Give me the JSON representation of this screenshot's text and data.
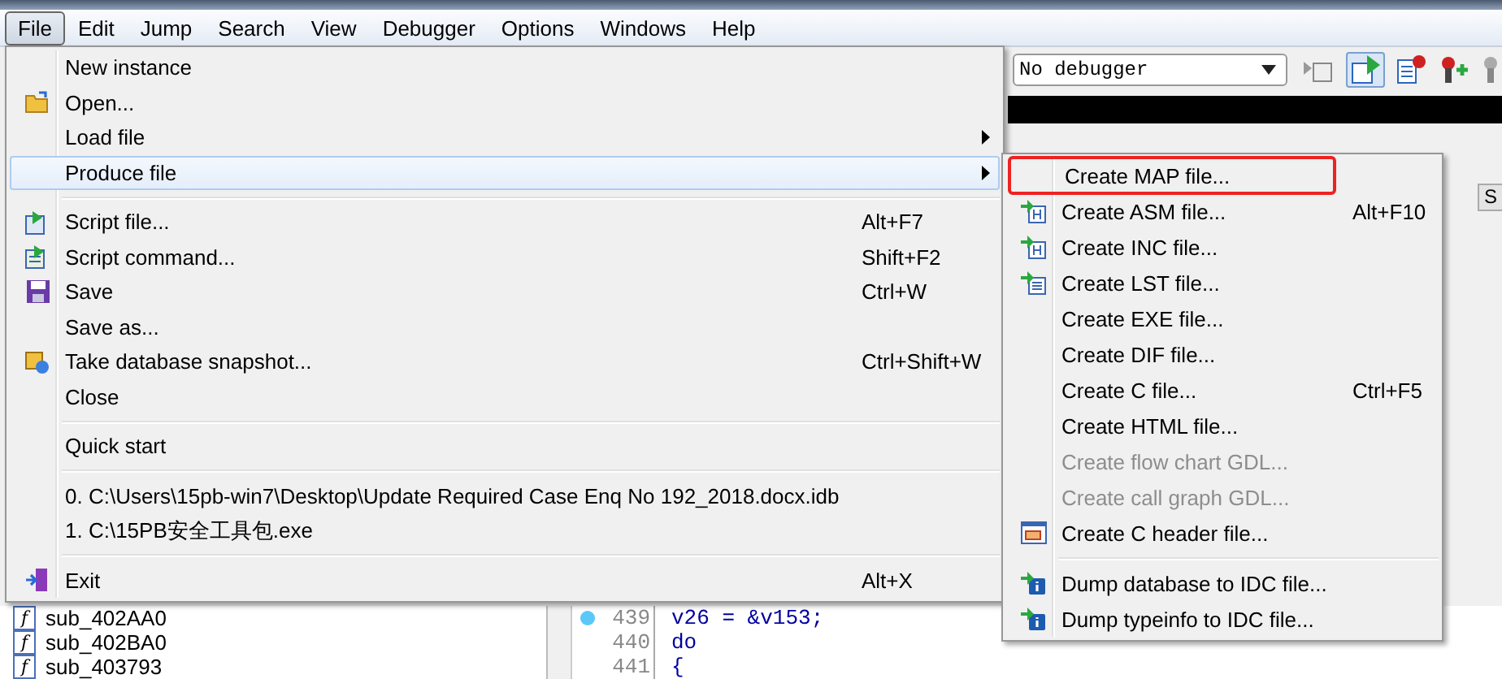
{
  "menubar": [
    {
      "label": "File",
      "selected": true
    },
    {
      "label": "Edit",
      "selected": false
    },
    {
      "label": "Jump",
      "selected": false
    },
    {
      "label": "Search",
      "selected": false
    },
    {
      "label": "View",
      "selected": false
    },
    {
      "label": "Debugger",
      "selected": false
    },
    {
      "label": "Options",
      "selected": false
    },
    {
      "label": "Windows",
      "selected": false
    },
    {
      "label": "Help",
      "selected": false
    }
  ],
  "toolbar": {
    "debugger_select": "No debugger"
  },
  "side_tab": {
    "label": "S"
  },
  "functions": [
    {
      "icon_glyph": "f",
      "name": "sub_402AA0"
    },
    {
      "icon_glyph": "f",
      "name": "sub_402BA0"
    },
    {
      "icon_glyph": "f",
      "name": "sub_403793"
    }
  ],
  "code_lines": [
    {
      "number": "439",
      "breakpoint": true,
      "text": "v26 = &v153;"
    },
    {
      "number": "440",
      "breakpoint": false,
      "text": "do"
    },
    {
      "number": "441",
      "breakpoint": false,
      "text": "{"
    }
  ],
  "file_menu": [
    {
      "kind": "item",
      "label": "New instance"
    },
    {
      "kind": "item",
      "label": "Open...",
      "icon": {
        "kind": "folder"
      }
    },
    {
      "kind": "item",
      "label": "Load file",
      "submenu": true
    },
    {
      "kind": "item",
      "label": "Produce file",
      "submenu": true,
      "selected": true
    },
    {
      "kind": "separator"
    },
    {
      "kind": "item",
      "label": "Script file...",
      "shortcut": "Alt+F7",
      "icon": {
        "kind": "script"
      }
    },
    {
      "kind": "item",
      "label": "Script command...",
      "shortcut": "Shift+F2",
      "icon": {
        "kind": "command"
      }
    },
    {
      "kind": "item",
      "label": "Save",
      "shortcut": "Ctrl+W",
      "icon": {
        "kind": "save"
      }
    },
    {
      "kind": "item",
      "label": "Save as..."
    },
    {
      "kind": "item",
      "label": "Take database snapshot...",
      "shortcut": "Ctrl+Shift+W",
      "icon": {
        "kind": "snapshot"
      }
    },
    {
      "kind": "item",
      "label": "Close"
    },
    {
      "kind": "separator"
    },
    {
      "kind": "item",
      "label": "Quick start"
    },
    {
      "kind": "separator"
    },
    {
      "kind": "item",
      "label": "0. C:\\Users\\15pb-win7\\Desktop\\Update Required Case Enq No 192_2018.docx.idb"
    },
    {
      "kind": "item",
      "label": "1. C:\\15PB安全工具包.exe"
    },
    {
      "kind": "separator"
    },
    {
      "kind": "item",
      "label": "Exit",
      "shortcut": "Alt+X",
      "icon": {
        "kind": "exit"
      }
    }
  ],
  "produce_submenu": [
    {
      "kind": "item",
      "label": "Create MAP file...",
      "annotated": true,
      "disabled": false
    },
    {
      "kind": "item",
      "label": "Create ASM file...",
      "shortcut": "Alt+F10",
      "icon": {
        "kind": "header-file"
      },
      "disabled": false
    },
    {
      "kind": "item",
      "label": "Create INC file...",
      "icon": {
        "kind": "header-file"
      },
      "disabled": false
    },
    {
      "kind": "item",
      "label": "Create LST file...",
      "icon": {
        "kind": "list-file"
      },
      "disabled": false
    },
    {
      "kind": "item",
      "label": "Create EXE file...",
      "disabled": false
    },
    {
      "kind": "item",
      "label": "Create DIF file...",
      "disabled": false
    },
    {
      "kind": "item",
      "label": "Create C file...",
      "shortcut": "Ctrl+F5",
      "disabled": false
    },
    {
      "kind": "item",
      "label": "Create HTML file...",
      "disabled": false
    },
    {
      "kind": "item",
      "label": "Create flow chart GDL...",
      "disabled": true
    },
    {
      "kind": "item",
      "label": "Create call graph GDL...",
      "disabled": true
    },
    {
      "kind": "item",
      "label": "Create C header file...",
      "icon": {
        "kind": "window"
      },
      "disabled": false
    },
    {
      "kind": "separator"
    },
    {
      "kind": "item",
      "label": "Dump database to IDC file...",
      "icon": {
        "kind": "info-file"
      },
      "disabled": false
    },
    {
      "kind": "item",
      "label": "Dump typeinfo to IDC file...",
      "icon": {
        "kind": "info-file"
      },
      "disabled": false
    }
  ]
}
